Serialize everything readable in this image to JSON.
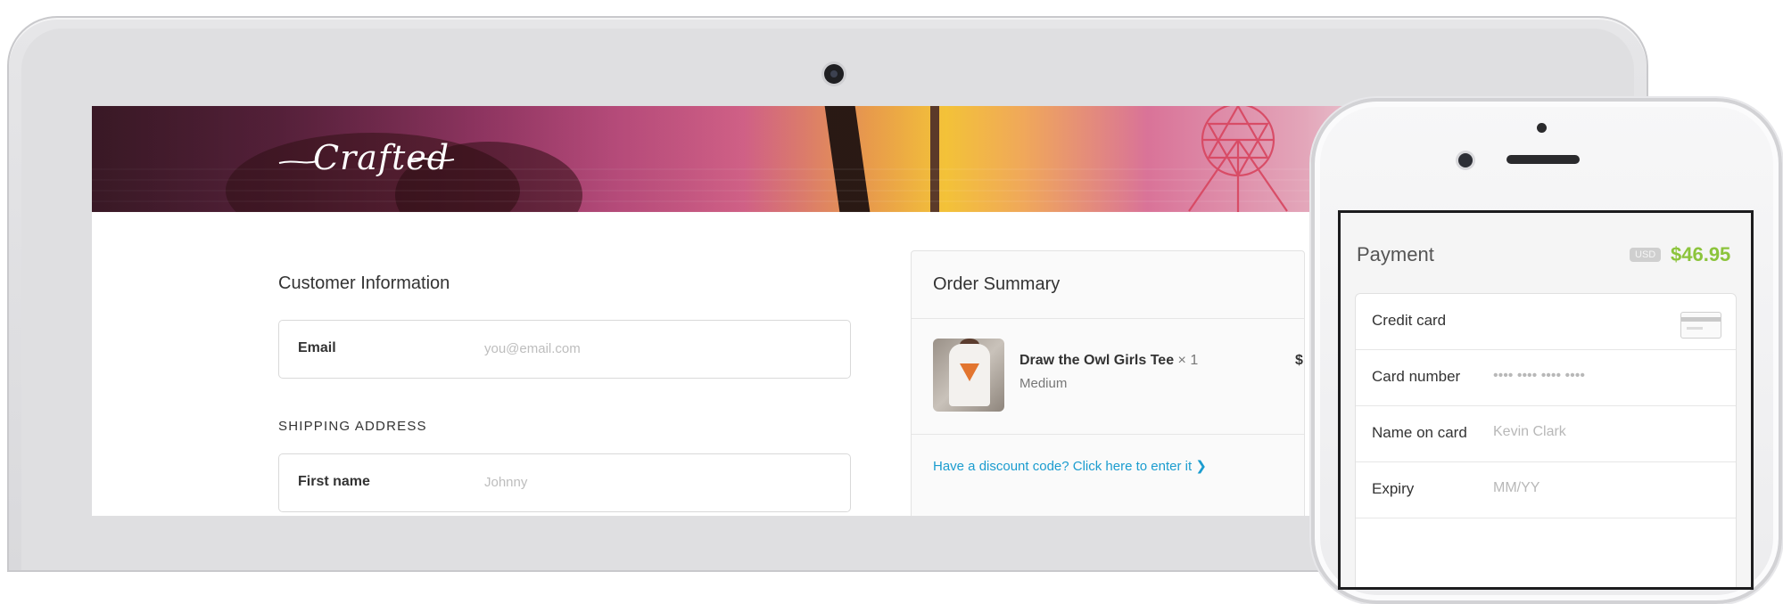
{
  "logo": {
    "text": "Crafted"
  },
  "checkout": {
    "customer_title": "Customer Information",
    "email": {
      "label": "Email",
      "placeholder": "you@email.com",
      "value": ""
    },
    "shipping_heading": "SHIPPING ADDRESS",
    "first_name": {
      "label": "First name",
      "placeholder": "Johnny",
      "value": ""
    }
  },
  "order_summary": {
    "title": "Order Summary",
    "item": {
      "name": "Draw the Owl Girls Tee",
      "quantity": "× 1",
      "variant": "Medium",
      "price": "$"
    },
    "discount_link": "Have a discount code? Click here to enter it ❯"
  },
  "phone_payment": {
    "title": "Payment",
    "currency": "USD",
    "amount": "$46.95",
    "amount_color": "#8cc43c",
    "rows": [
      {
        "label": "Credit card",
        "placeholder": "",
        "icon": "credit-card-icon"
      },
      {
        "label": "Card number",
        "placeholder": "•••• •••• •••• ••••"
      },
      {
        "label": "Name on card",
        "placeholder": "Kevin Clark"
      },
      {
        "label": "Expiry",
        "placeholder": "MM/YY"
      }
    ]
  },
  "colors": {
    "link": "#1b9ccf",
    "accent_green": "#8cc43c"
  }
}
